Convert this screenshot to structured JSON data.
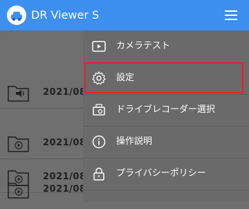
{
  "app": {
    "title": "DR Viewer S"
  },
  "list": {
    "rows": [
      {
        "date": "2021/08/",
        "icon": "sound-folder-icon"
      },
      {
        "date": "2021/08/",
        "icon": "video-folder-icon"
      },
      {
        "date": "2021/08/",
        "icon": "video-folder-icon"
      },
      {
        "date": "2021/08/",
        "icon": "video-folder-icon"
      }
    ]
  },
  "drawer": {
    "items": [
      {
        "label": "カメラテスト",
        "icon": "camera-test-icon"
      },
      {
        "label": "設定",
        "icon": "gear-icon",
        "highlighted": true
      },
      {
        "label": "ドライブレコーダー選択",
        "icon": "dashcam-icon"
      },
      {
        "label": "操作説明",
        "icon": "info-icon"
      },
      {
        "label": "プライバシーポリシー",
        "icon": "lock-icon"
      }
    ]
  },
  "colors": {
    "appbar": "#3d8ff0",
    "highlight": "#e8202a",
    "overlay": "#6e6e6e"
  }
}
